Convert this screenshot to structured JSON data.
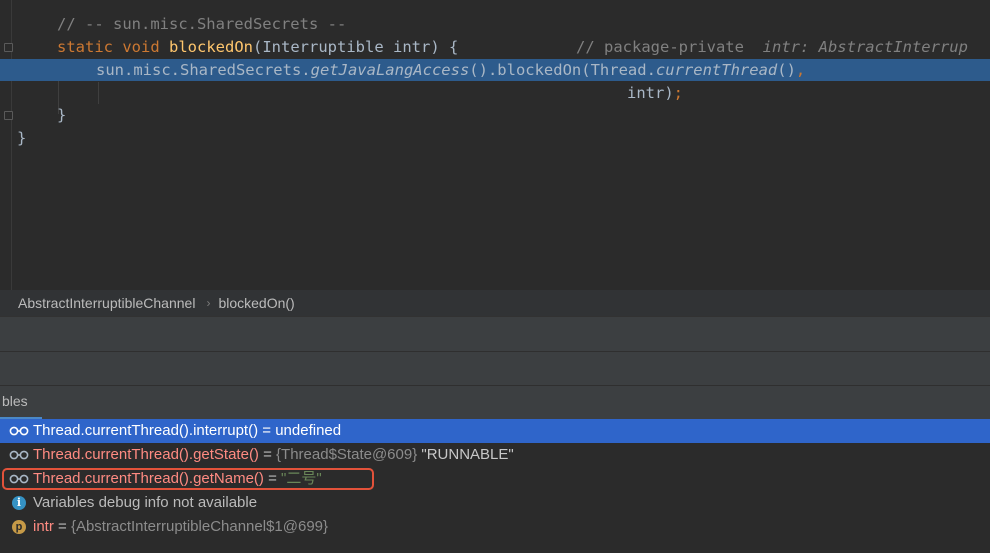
{
  "editor": {
    "line1": {
      "comment": "// -- sun.misc.SharedSecrets --"
    },
    "line2": {
      "kw_static": "static",
      "kw_void": "void",
      "method": "blockedOn",
      "params": "(Interruptible intr) {",
      "comment": "// package-private",
      "hint": "intr: AbstractInterrup"
    },
    "line3": {
      "part1": "sun.misc.SharedSecrets.",
      "part2": "getJavaLangAccess",
      "part3": "().blockedOn(Thread.",
      "part4": "currentThread",
      "part5": "()",
      "part6": ","
    },
    "line4": {
      "arg": "intr)",
      "semi": ";"
    },
    "line5": {
      "brace": "}"
    },
    "line6": {
      "brace": "}"
    }
  },
  "breadcrumb": {
    "class_name": "AbstractInterruptibleChannel",
    "separator": "›",
    "method_name": "blockedOn()"
  },
  "tabs": {
    "variables_label": "bles"
  },
  "variables": [
    {
      "name": "Thread.currentThread().interrupt()",
      "eq": " = ",
      "value": "undefined",
      "selected": true
    },
    {
      "name": "Thread.currentThread().getState()",
      "eq": " = ",
      "type_value": "{Thread$State@609}",
      "value": " \"RUNNABLE\""
    },
    {
      "name": "Thread.currentThread().getName()",
      "eq": " = ",
      "value": "\"二号\""
    },
    {
      "info": "Variables debug info not available"
    },
    {
      "name": "intr",
      "eq": " = ",
      "type_value": "{AbstractInterruptibleChannel$1@699}"
    }
  ],
  "icons": {
    "watch": "glasses-icon",
    "info": "info-icon",
    "param": "parameter-icon"
  },
  "colors": {
    "selection": "#2f65ca",
    "highlight_box": "#e2523a",
    "keyword": "#cc7832",
    "method": "#ffc66d"
  }
}
